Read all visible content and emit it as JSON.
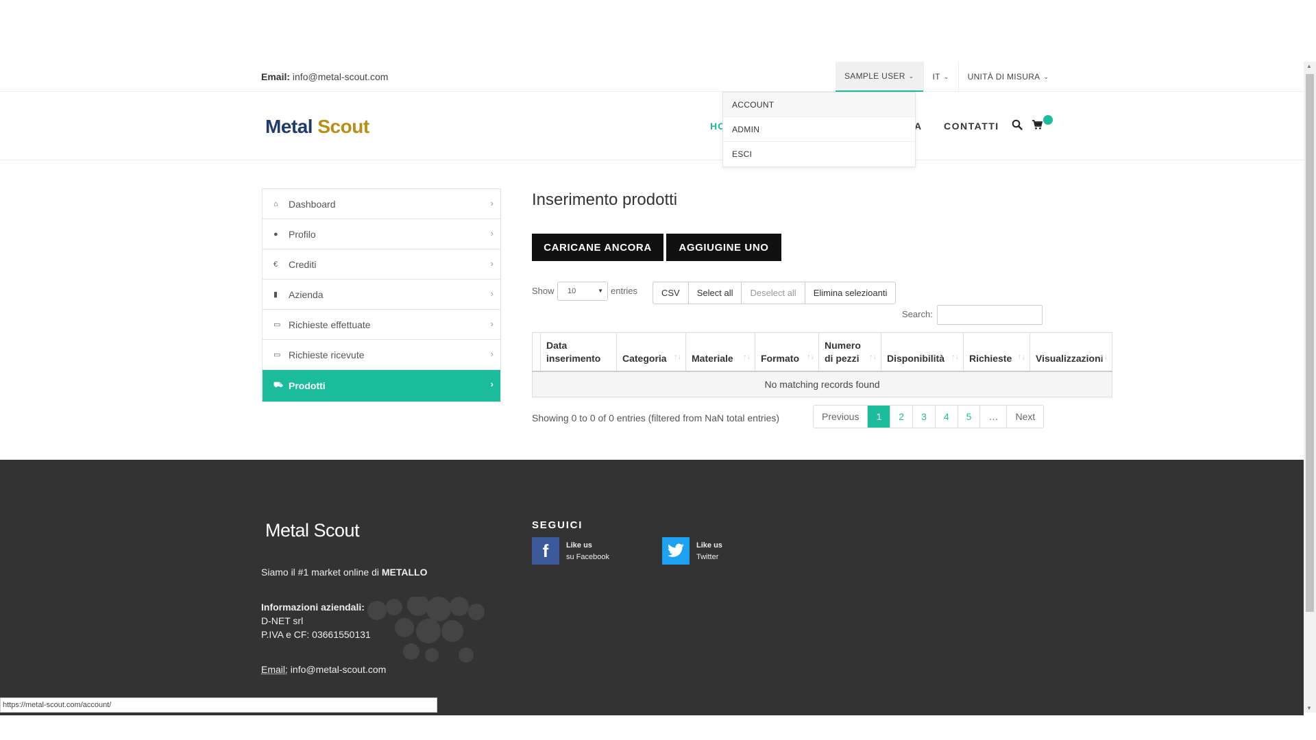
{
  "topbar": {
    "email_label": "Email:",
    "email_value": "info@metal-scout.com",
    "user_menu": "SAMPLE USER",
    "language": "IT",
    "units": "UNITÀ DI MISURA"
  },
  "user_dropdown": {
    "items": [
      {
        "label": "ACCOUNT"
      },
      {
        "label": "ADMIN"
      },
      {
        "label": "ESCI"
      }
    ]
  },
  "header": {
    "logo_part1": "Metal",
    "logo_part2": "Scout",
    "nav_home_fragment": "HO",
    "nav_hidden_fragment": "A",
    "nav_contatti": "CONTATTI",
    "search_icon": "search-icon",
    "cart_icon": "cart-icon",
    "badge_color": "#1abc9c"
  },
  "sidebar": {
    "items": [
      {
        "label": "Dashboard",
        "icon": "home-icon",
        "glyph": "⌂"
      },
      {
        "label": "Profilo",
        "icon": "user-icon",
        "glyph": "●"
      },
      {
        "label": "Crediti",
        "icon": "euro-icon",
        "glyph": "€"
      },
      {
        "label": "Azienda",
        "icon": "bar-chart-icon",
        "glyph": "▮"
      },
      {
        "label": "Richieste effettuate",
        "icon": "chat-icon",
        "glyph": "▭"
      },
      {
        "label": "Richieste ricevute",
        "icon": "chat-icon",
        "glyph": "▭"
      },
      {
        "label": "Prodotti",
        "icon": "cart-icon",
        "glyph": "⛟",
        "active": true
      }
    ],
    "accent": "#1abc9c"
  },
  "main": {
    "title": "Inserimento prodotti",
    "btn_upload": "CARICANE ANCORA",
    "btn_add": "AGGIUGINE UNO",
    "show_label": "Show",
    "show_value": "10",
    "entries_label": "entries",
    "tools": {
      "csv": "CSV",
      "select_all": "Select all",
      "deselect_all": "Deselect all",
      "delete_selected": "Elimina selezioanti"
    },
    "search_label": "Search:",
    "search_value": "",
    "columns": [
      "Data inserimento",
      "Categoria",
      "Materiale",
      "Formato",
      "Numero di pezzi",
      "Disponibilità",
      "Richieste",
      "Visualizzazioni"
    ],
    "empty_message": "No matching records found",
    "info": "Showing 0 to 0 of 0 entries (filtered from NaN total entries)",
    "pagination": {
      "previous": "Previous",
      "pages": [
        "1",
        "2",
        "3",
        "4",
        "5",
        "…"
      ],
      "current": "1",
      "next": "Next"
    }
  },
  "footer": {
    "logo": "Metal Scout",
    "tagline_prefix": "Siamo il #1 market online di",
    "tagline_bold": "METALLO",
    "company_heading": "Informazioni aziendali:",
    "company_name": "D-NET srl",
    "vat": "P.IVA e CF: 03661550131",
    "email_label": "Email:",
    "email_value": "info@metal-scout.com",
    "follow_heading": "SEGUICI",
    "facebook": {
      "line1": "Like us",
      "line2": "su Facebook",
      "color": "#3b5998"
    },
    "twitter": {
      "line1": "Like us",
      "line2": "Twitter",
      "color": "#1da1f2"
    }
  },
  "statusbar": {
    "url": "https://metal-scout.com/account/"
  }
}
